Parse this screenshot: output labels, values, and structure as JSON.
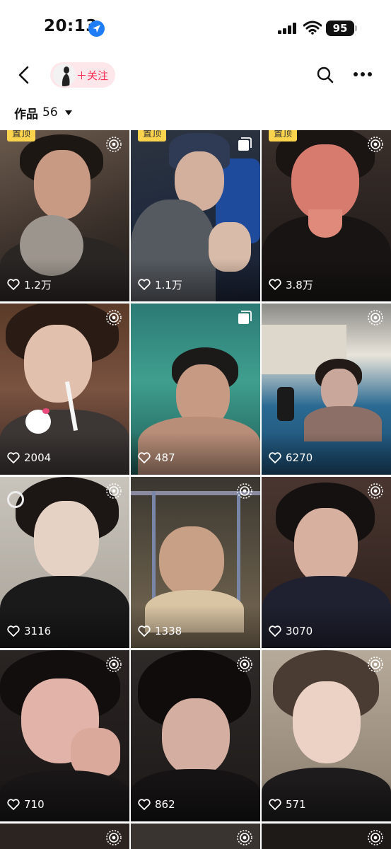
{
  "status_bar": {
    "time": "20:13",
    "battery": "95",
    "icons": [
      "location-arrow-icon",
      "signal-icon",
      "wifi-icon",
      "battery-icon"
    ]
  },
  "nav": {
    "follow_label": "＋关注",
    "icons": [
      "back-icon",
      "search-icon",
      "more-icon"
    ]
  },
  "works": {
    "label": "作品",
    "count": "56"
  },
  "colors": {
    "accent": "#fe2c55",
    "pin_badge": "#fcd34d",
    "location_blue": "#1f7ef7"
  },
  "videos": [
    {
      "likes": "1.2万",
      "pinned": true,
      "pin_label": "置顶",
      "corner_icon": "live-photo-icon"
    },
    {
      "likes": "1.1万",
      "pinned": true,
      "pin_label": "置顶",
      "corner_icon": "gallery-icon"
    },
    {
      "likes": "3.8万",
      "pinned": true,
      "pin_label": "置顶",
      "corner_icon": "live-photo-icon"
    },
    {
      "likes": "2004",
      "pinned": false,
      "corner_icon": "live-photo-icon"
    },
    {
      "likes": "487",
      "pinned": false,
      "corner_icon": "gallery-icon"
    },
    {
      "likes": "6270",
      "pinned": false,
      "corner_icon": "live-photo-icon"
    },
    {
      "likes": "3116",
      "pinned": false,
      "corner_icon": "live-photo-icon"
    },
    {
      "likes": "1338",
      "pinned": false,
      "corner_icon": "live-photo-icon"
    },
    {
      "likes": "3070",
      "pinned": false,
      "corner_icon": "live-photo-icon"
    },
    {
      "likes": "710",
      "pinned": false,
      "corner_icon": "live-photo-icon"
    },
    {
      "likes": "862",
      "pinned": false,
      "corner_icon": "live-photo-icon"
    },
    {
      "likes": "571",
      "pinned": false,
      "corner_icon": "live-photo-icon"
    },
    {
      "likes": "",
      "pinned": false,
      "corner_icon": "live-photo-icon"
    },
    {
      "likes": "",
      "pinned": false,
      "corner_icon": "live-photo-icon"
    },
    {
      "likes": "",
      "pinned": false,
      "corner_icon": "live-photo-icon"
    }
  ]
}
